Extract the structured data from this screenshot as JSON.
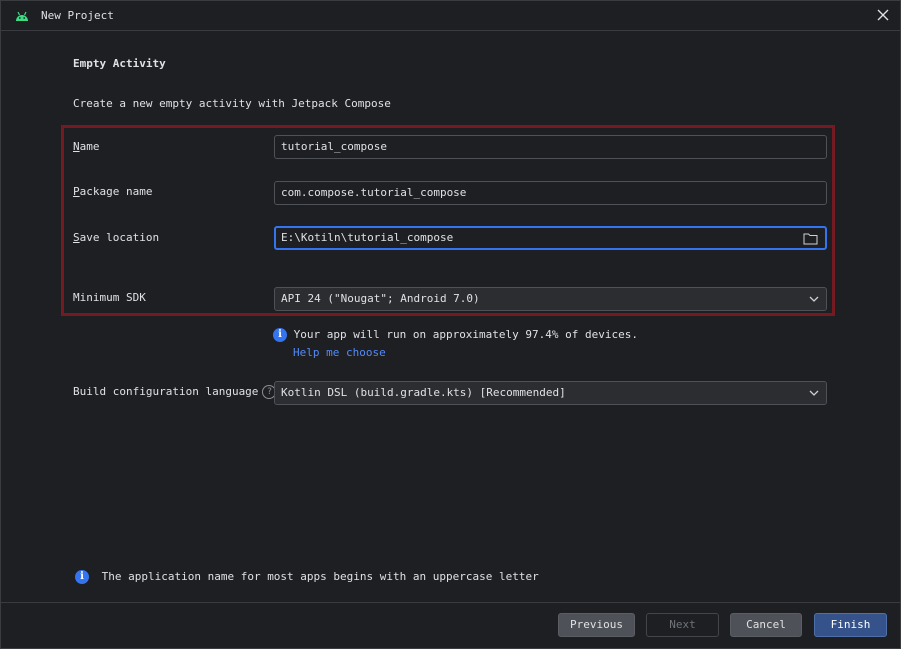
{
  "window": {
    "title": "New Project"
  },
  "header": {
    "title": "Empty Activity",
    "description": "Create a new empty activity with Jetpack Compose"
  },
  "form": {
    "name": {
      "label_mn": "N",
      "label_rest": "ame",
      "value": "tutorial_compose"
    },
    "package": {
      "label_mn": "P",
      "label_rest": "ackage name",
      "value": "com.compose.tutorial_compose"
    },
    "save_location": {
      "label_mn": "S",
      "label_rest": "ave location",
      "value": "E:\\Kotiln\\tutorial_compose"
    },
    "min_sdk": {
      "label": "Minimum SDK",
      "value": "API 24 (\"Nougat\"; Android 7.0)"
    },
    "devices_info": "Your app will run on approximately 97.4% of devices.",
    "help_link": "Help me choose",
    "build_lang": {
      "label": "Build configuration language",
      "value": "Kotlin DSL (build.gradle.kts) [Recommended]"
    }
  },
  "footer_info": "The application name for most apps begins with an uppercase letter",
  "buttons": {
    "previous": "Previous",
    "next": "Next",
    "cancel": "Cancel",
    "finish": "Finish"
  },
  "colors": {
    "accent": "#3574f0",
    "highlight": "#731b20",
    "android_green": "#3ddc84"
  }
}
